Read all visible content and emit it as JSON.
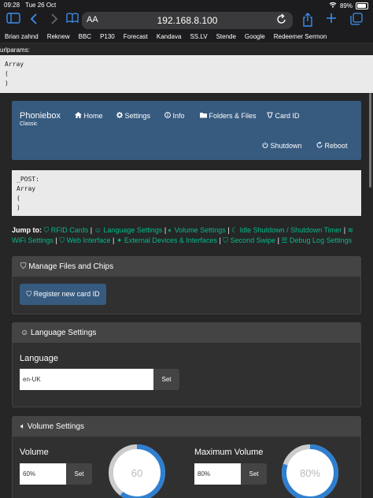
{
  "status": {
    "time": "09:28",
    "date": "Tue 26 Oct",
    "battery": "89%",
    "battery_level": 0.89
  },
  "browser": {
    "address_text_size": "AA",
    "url": "192.168.8.100",
    "bookmarks": [
      "Brian zahnd",
      "Reknew",
      "BBC",
      "P130",
      "Forecast",
      "Kandava",
      "SS.LV",
      "Stende",
      "Google",
      "Redeemer Sermon"
    ]
  },
  "page": {
    "urlparams_label": "urlparams:",
    "urlparams_lines": [
      "Array",
      "(",
      ")"
    ],
    "post_lines": [
      "_POST:",
      "Array",
      "(",
      ")"
    ],
    "navbar": {
      "brand": "Phoniebox",
      "brand_sub": "Classic",
      "home": "Home",
      "settings": "Settings",
      "info": "Info",
      "folders": "Folders & Files",
      "cardid": "Card ID",
      "shutdown": "Shutdown",
      "reboot": "Reboot"
    },
    "jump": {
      "label": "Jump to:",
      "rfid": "RFID Cards",
      "language": "Language Settings",
      "volume": "Volume Settings",
      "idle": "Idle Shutdown / Shutdown Timer",
      "wifi": "WiFi Settings",
      "web": "Web Interface",
      "external": "External Devices & Interfaces",
      "swipe": "Second Swipe",
      "debug": "Debug Log Settings"
    },
    "manage": {
      "title": "Manage Files and Chips",
      "button": "Register new card ID"
    },
    "language_panel": {
      "title": "Language Settings",
      "label": "Language",
      "value": "en-UK",
      "set": "Set"
    },
    "volume_panel": {
      "title": "Volume Settings",
      "volume_label": "Volume",
      "volume_value": "60%",
      "volume_knob": "60",
      "volume_level": 60,
      "max_label": "Maximum Volume",
      "max_value": "80%",
      "max_knob": "80%",
      "max_level": 80,
      "set": "Set"
    }
  },
  "colors": {
    "accent": "#375a7f",
    "link": "#00bc8c",
    "ios_blue": "#3b8ef0"
  }
}
